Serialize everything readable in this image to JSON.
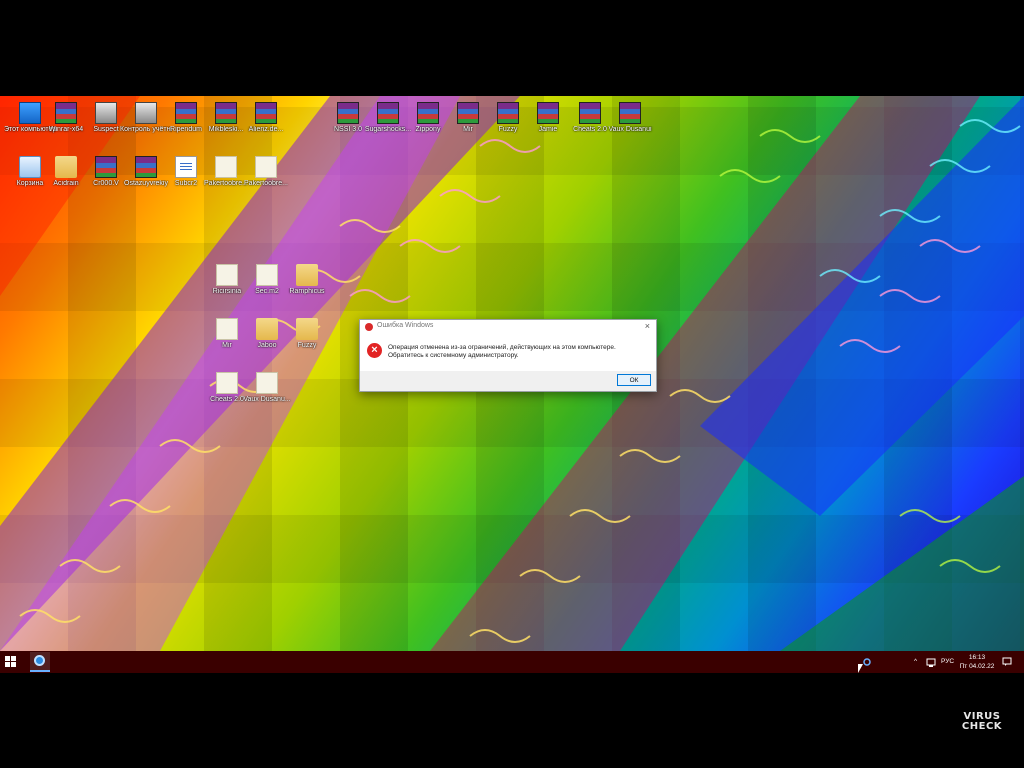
{
  "desktop": {
    "row1": [
      {
        "label": "Этот компьютер",
        "kind": "pc"
      },
      {
        "label": "Winrar-x64",
        "kind": "rar"
      },
      {
        "label": "Suspect",
        "kind": "exe"
      },
      {
        "label": "Контроль учётных...",
        "kind": "exe"
      },
      {
        "label": "Ripendum",
        "kind": "rar"
      },
      {
        "label": "Mikbleski...",
        "kind": "rar"
      },
      {
        "label": "Alienz.de...",
        "kind": "rar"
      },
      {
        "label": "NSSI 3.0",
        "kind": "rar"
      },
      {
        "label": "Sugarshocks...",
        "kind": "rar"
      },
      {
        "label": "Zippony",
        "kind": "rar"
      },
      {
        "label": "Mir",
        "kind": "rar"
      },
      {
        "label": "Fuzzy",
        "kind": "rar"
      },
      {
        "label": "Jamie",
        "kind": "rar"
      },
      {
        "label": "Cheats 2.0",
        "kind": "rar"
      },
      {
        "label": "Vaux Dusanui",
        "kind": "rar"
      }
    ],
    "row2": [
      {
        "label": "Корзина",
        "kind": "bin"
      },
      {
        "label": "Acidrain",
        "kind": "folder"
      },
      {
        "label": "Cr000.V",
        "kind": "rar"
      },
      {
        "label": "Ostazuyvrekiy",
        "kind": "rar"
      },
      {
        "label": "Subcr2",
        "kind": "doc"
      },
      {
        "label": "Pakertoobre...",
        "kind": "file"
      },
      {
        "label": "Pakertoobre...",
        "kind": "file"
      }
    ],
    "cluster": [
      {
        "label": "Ricirsinia",
        "kind": "file"
      },
      {
        "label": "Sec.m2",
        "kind": "file"
      },
      {
        "label": "Ramphicus",
        "kind": "folder"
      },
      {
        "label": "Mir",
        "kind": "file"
      },
      {
        "label": "Jaboo",
        "kind": "folder"
      },
      {
        "label": "Fuzzy",
        "kind": "folder"
      },
      {
        "label": "Cheats 2.0",
        "kind": "file"
      },
      {
        "label": "Vaux Dusanu...",
        "kind": "file"
      }
    ]
  },
  "dialog": {
    "title": "Ошибка Windows",
    "message": "Операция отменена из-за ограничений, действующих на этом компьютере. Обратитесь к системному администратору.",
    "ok_label": "ОК",
    "close_glyph": "×"
  },
  "taskbar": {
    "tray_chevron": "^",
    "language": "РУС",
    "time": "16:13",
    "date": "Пт 04.02.22"
  },
  "watermark": {
    "line1": "VIRUS",
    "line2": "CHECK"
  }
}
